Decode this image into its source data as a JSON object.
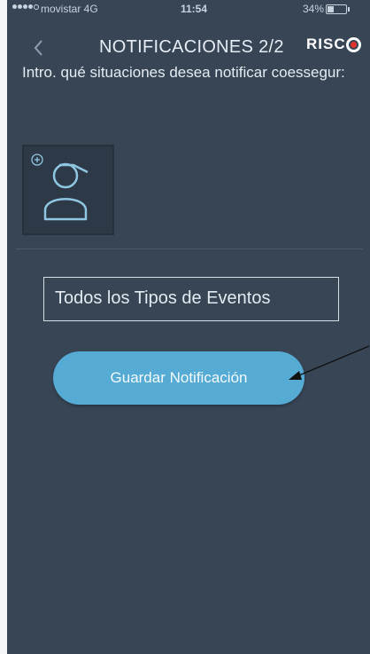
{
  "status_bar": {
    "carrier": "movistar 4G",
    "time": "11:54",
    "battery": "34%",
    "battery_level": 0.34
  },
  "header": {
    "back_icon": "chevron-left-icon",
    "title": "NOTIFICACIONES 2/2",
    "logo_text": "RISC"
  },
  "intro": {
    "text": "Intro. qué situaciones desea notificar coessegur:"
  },
  "avatar": {
    "icon": "user-add-icon"
  },
  "event_selector": {
    "value": "Todos los Tipos de Eventos"
  },
  "save_button": {
    "label": "Guardar Notificación"
  },
  "colors": {
    "background": "#374555",
    "accent_button": "#55abd4",
    "text": "#e5ecf2",
    "logo_mark": "#e2322b"
  }
}
